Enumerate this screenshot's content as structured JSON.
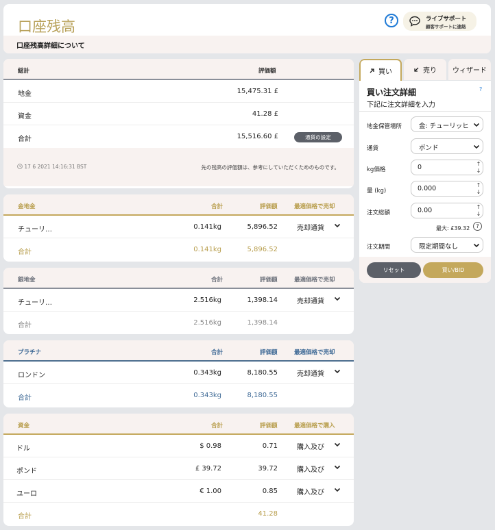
{
  "header": {
    "title": "口座残高",
    "help_label": "?",
    "live_support_title": "ライブサポート",
    "live_support_sub": "顧客サポートに連絡",
    "subtitle": "口座残高詳細について"
  },
  "summary": {
    "col_total": "総計",
    "col_value": "評価額",
    "rows": [
      {
        "label": "地金",
        "value": "15,475.31 £"
      },
      {
        "label": "資金",
        "value": "41.28 £"
      },
      {
        "label": "合計",
        "value": "15,516.60 £"
      }
    ],
    "currency_button": "通貨の設定",
    "timestamp": "17 6 2021 14:16:31 BST",
    "note": "先の残高の評価額は、参考にしていただくためのものです。"
  },
  "gold": {
    "title": "金地金",
    "col_total": "合計",
    "col_value": "評価額",
    "col_action": "最適価格で売却",
    "rows": [
      {
        "name": "チューリ…",
        "qty": "0.141kg",
        "value": "5,896.52",
        "action": "売却通貨"
      }
    ],
    "total_label": "合計",
    "total_qty": "0.141kg",
    "total_value": "5,896.52"
  },
  "silver": {
    "title": "銀地金",
    "col_total": "合計",
    "col_value": "評価額",
    "col_action": "最適価格で売却",
    "rows": [
      {
        "name": "チューリ…",
        "qty": "2.516kg",
        "value": "1,398.14",
        "action": "売却通貨"
      }
    ],
    "total_label": "合計",
    "total_qty": "2.516kg",
    "total_value": "1,398.14"
  },
  "platinum": {
    "title": "プラチナ",
    "col_total": "合計",
    "col_value": "評価額",
    "col_action": "最適価格で売却",
    "rows": [
      {
        "name": "ロンドン",
        "qty": "0.343kg",
        "value": "8,180.55",
        "action": "売却通貨"
      }
    ],
    "total_label": "合計",
    "total_qty": "0.343kg",
    "total_value": "8,180.55"
  },
  "funds": {
    "title": "資金",
    "col_total": "合計",
    "col_value": "評価額",
    "col_action": "最適価格で購入",
    "rows": [
      {
        "name": "ドル",
        "amount": "$ 0.98",
        "value": "0.71",
        "action": "購入及び"
      },
      {
        "name": "ポンド",
        "amount": "£ 39.72",
        "value": "39.72",
        "action": "購入及び"
      },
      {
        "name": "ユーロ",
        "amount": "€ 1.00",
        "value": "0.85",
        "action": "購入及び"
      }
    ],
    "total_label": "合計",
    "total_value": "41.28"
  },
  "order": {
    "tab_buy": "買い",
    "tab_sell": "売り",
    "tab_wizard": "ウィザード",
    "title": "買い注文詳細",
    "help": "?",
    "subtitle": "下記に注文詳細を入力",
    "storage_label": "地金保管場所",
    "storage_value": "金: チューリッヒ",
    "currency_label": "通貨",
    "currency_value": "ポンド",
    "price_label": "kg価格",
    "price_value": "0",
    "qty_label": "量 (kg)",
    "qty_value": "0.000",
    "total_label": "注文総額",
    "total_value": "0.00",
    "max_text": "最大: £39.32",
    "max_help": "?",
    "period_label": "注文期間",
    "period_value": "限定期間なし",
    "reset_button": "リセット",
    "buy_button": "買い/BID"
  },
  "colors": {
    "gold": "#c4a85c",
    "silver": "#8a8f99",
    "platinum": "#4d6f8f",
    "dark_button": "#5c6068",
    "help_blue": "#1f7ad6"
  }
}
